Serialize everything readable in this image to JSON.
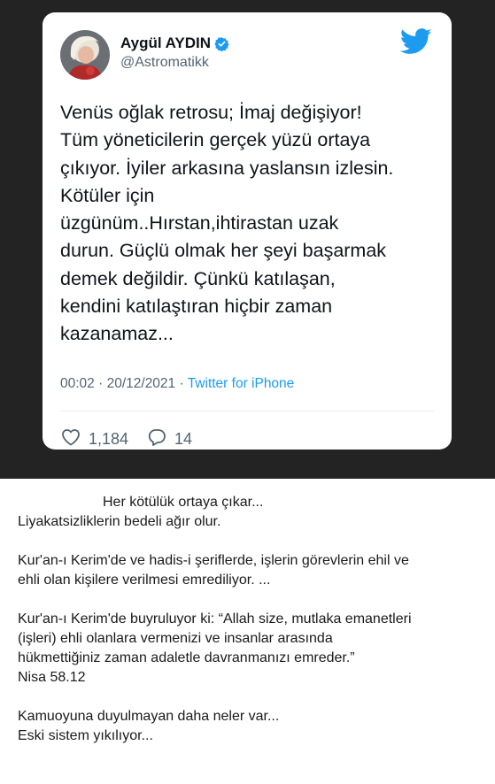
{
  "tweet": {
    "user_name": "Aygül AYDIN",
    "user_handle": "@Astromatikk",
    "text_lines": [
      "Venüs oğlak retrosu; İmaj değişiyor!",
      "Tüm yöneticilerin gerçek yüzü ortaya",
      "çıkıyor. İyiler arkasına yaslansın izlesin.",
      "Kötüler için",
      "üzgünüm..Hırstan,ihtirastan uzak",
      "durun. Güçlü olmak her şeyi başarmak",
      "demek değildir. Çünkü katılaşan,",
      "kendini katılaştıran hiçbir zaman",
      "kazanamaz..."
    ],
    "time": "00:02",
    "date": "20/12/2021",
    "separator": "·",
    "source": "Twitter for iPhone",
    "likes": "1,184",
    "replies": "14",
    "icons": {
      "verified": "verified-badge-icon",
      "brand": "twitter-bird-icon",
      "like": "heart-icon",
      "reply": "reply-bubble-icon"
    },
    "colors": {
      "brand": "#1d9bf0",
      "background": "#232323"
    }
  },
  "caption": {
    "lines": [
      "Her kötülük ortaya çıkar...",
      "Liyakatsizliklerin bedeli ağır olur.",
      "",
      "Kur'an-ı Kerim'de ve hadis-i şeriflerde, işlerin görevlerin ehil ve",
      "ehli olan kişilere verilmesi emrediliyor. ...",
      "",
      "Kur'an-ı Kerim'de buyruluyor ki: “Allah size, mutlaka emanetleri",
      "(işleri) ehli olanlara vermenizi ve insanlar arasında",
      "hükmettiğiniz zaman adaletle davranmanızı emreder.”",
      "Nisa 58.12",
      "",
      "Kamuoyuna duyulmayan daha neler var...",
      "Eski sistem yıkılıyor..."
    ]
  }
}
